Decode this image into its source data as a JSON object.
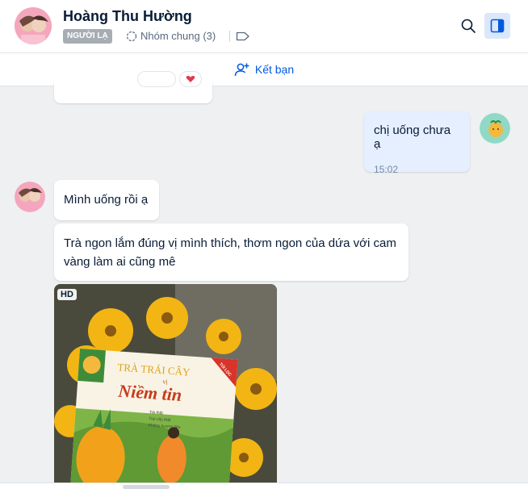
{
  "header": {
    "contact_name": "Hoàng Thu Hường",
    "badge": "NGƯỜI LẠ",
    "common_groups": "Nhóm chung (3)",
    "icons": [
      "people-icon",
      "tag-icon",
      "search-icon",
      "panel-toggle-icon"
    ]
  },
  "add_friend": {
    "label": "Kết bạn",
    "icon": "add-user-icon"
  },
  "messages": [
    {
      "from": "me",
      "text": "chị uống chưa ạ",
      "time": "15:02"
    },
    {
      "from": "other",
      "text": "Mình uống rồi ạ"
    },
    {
      "from": "other",
      "text": "Trà ngon lắm đúng vị mình thích, thơm ngon của dứa với cam vàng làm ai cũng mê"
    }
  ],
  "photo": {
    "badge": "HD",
    "product_title_1": "TRÀ TRÁI CÂY",
    "product_title_small": "vị",
    "product_title_2": "Niềm tin",
    "ribbon": "TÚI LỌC",
    "bullets": [
      "Trà thật",
      "Trái cây thật",
      "Không hương liệu"
    ]
  },
  "colors": {
    "accent": "#005ae0",
    "me_bubble": "#e5efff",
    "chat_bg": "#eef0f1"
  }
}
